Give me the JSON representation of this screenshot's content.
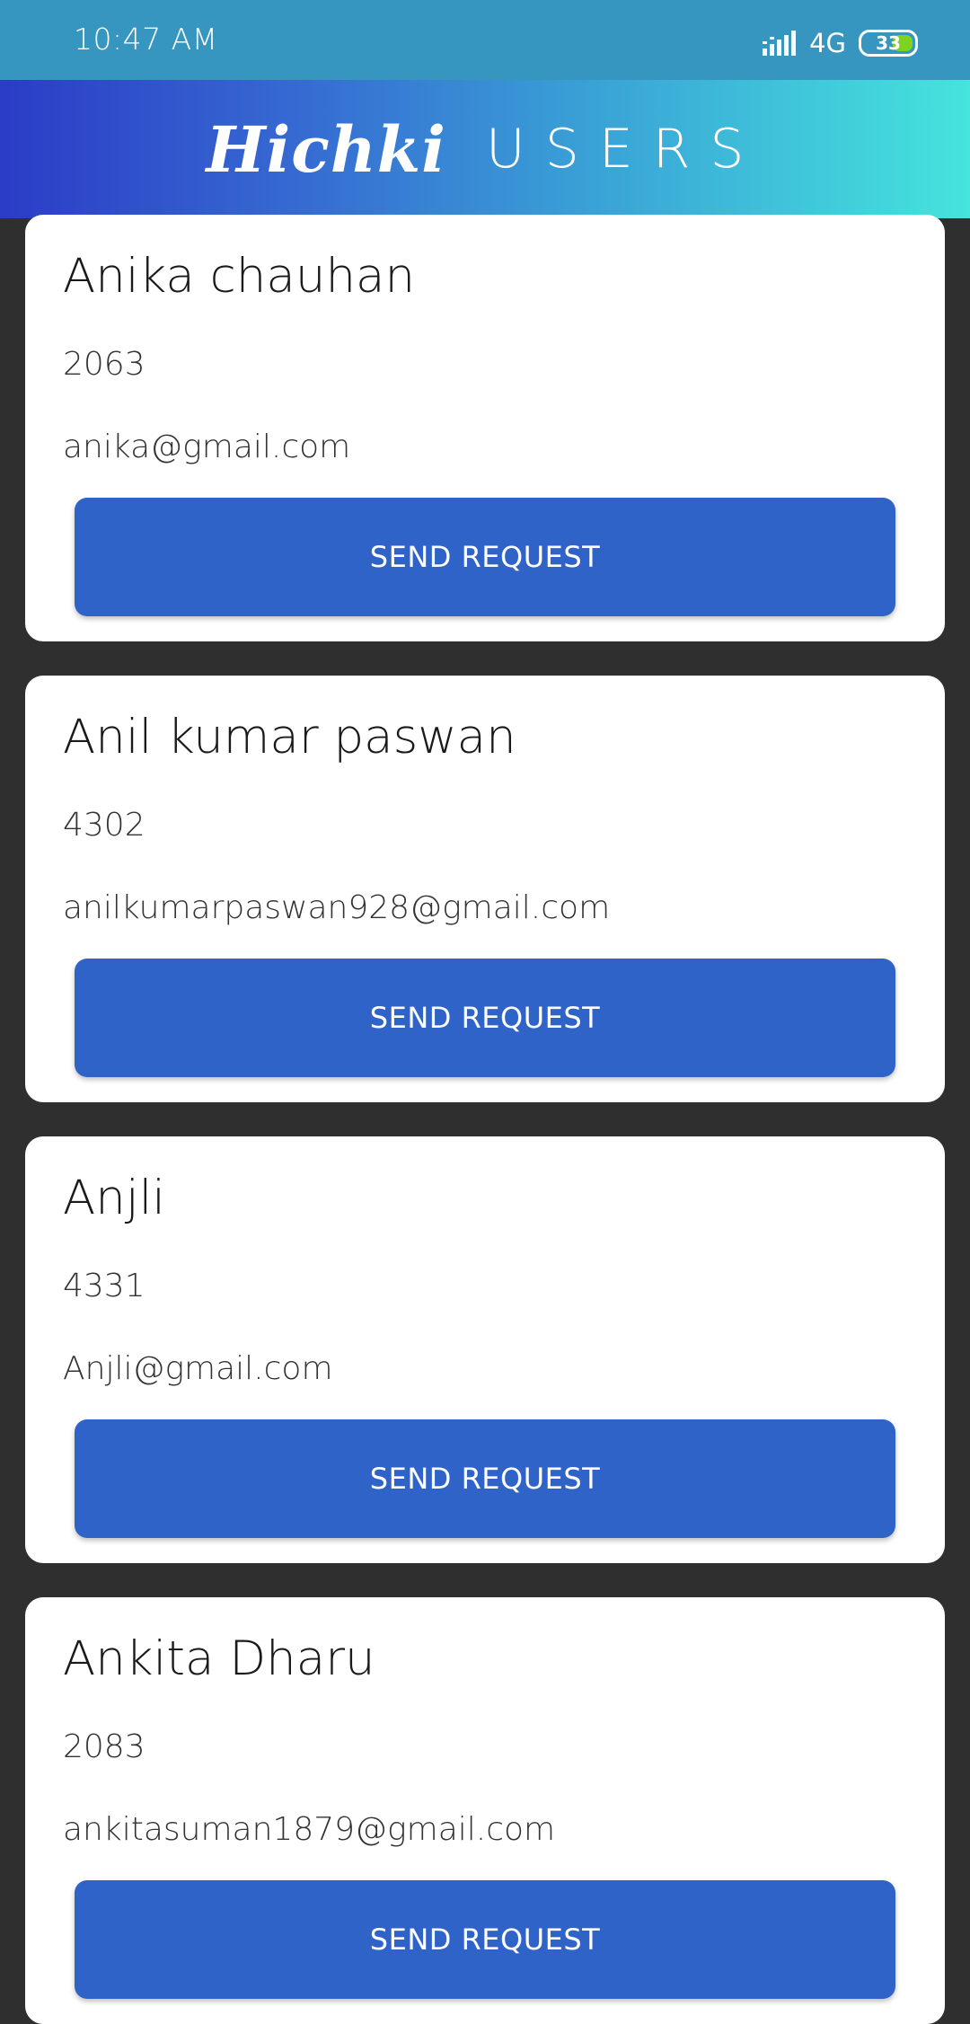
{
  "status_bar": {
    "time": "10:47 AM",
    "network": "4G",
    "battery": "33",
    "battery_color": "#7ed321"
  },
  "header": {
    "brand": "Hichki",
    "title": "USERS",
    "gradient_start": "#2b3cc6",
    "gradient_end": "#45e4dd"
  },
  "users": [
    {
      "name": "Anika chauhan",
      "code": "2063",
      "email": "anika@gmail.com",
      "button_label": "SEND REQUEST"
    },
    {
      "name": "Anil kumar paswan",
      "code": "4302",
      "email": "anilkumarpaswan928@gmail.com",
      "button_label": "SEND REQUEST"
    },
    {
      "name": "Anjli",
      "code": "4331",
      "email": "Anjli@gmail.com",
      "button_label": "SEND REQUEST"
    },
    {
      "name": "Ankita Dharu",
      "code": "2083",
      "email": "ankitasuman1879@gmail.com",
      "button_label": "SEND REQUEST"
    }
  ],
  "colors": {
    "background": "#2f2f2f",
    "button": "#3063c8",
    "status_bar": "#3696c0"
  }
}
